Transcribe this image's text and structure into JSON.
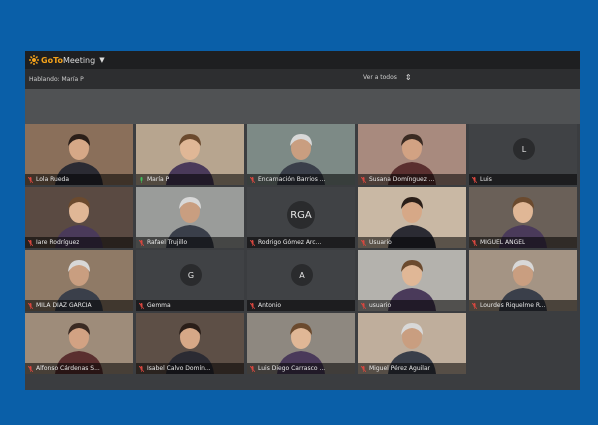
{
  "app": {
    "brand_bold": "GoTo",
    "brand_light": "Meeting",
    "speaking_label": "Hablando: María P",
    "view_all_label": "Ver a todos"
  },
  "colors": {
    "frame_blue": "#0a5fa8",
    "brand_orange": "#f4a21a",
    "mic_muted": "#d9473f",
    "mic_active": "#3fbf5a"
  },
  "participants": [
    {
      "name": "Lola Rueda",
      "type": "video",
      "mic": "muted"
    },
    {
      "name": "María P",
      "type": "video",
      "mic": "active"
    },
    {
      "name": "Encarnación Barrios ...",
      "type": "video",
      "mic": "muted"
    },
    {
      "name": "Susana Domínguez ...",
      "type": "video",
      "mic": "muted"
    },
    {
      "name": "Luis",
      "type": "avatar",
      "initials": "L",
      "mic": "muted"
    },
    {
      "name": "Iare Rodríguez",
      "type": "video",
      "mic": "muted"
    },
    {
      "name": "Rafael Trujillo",
      "type": "video",
      "mic": "muted"
    },
    {
      "name": "Rodrigo Gómez Arc...",
      "type": "avatar",
      "initials": "RGA",
      "mic": "muted"
    },
    {
      "name": "Usuario",
      "type": "video",
      "mic": "muted"
    },
    {
      "name": "MIGUEL ANGEL",
      "type": "video",
      "mic": "muted"
    },
    {
      "name": "MILA DÍAZ GARCÍA",
      "type": "video",
      "mic": "muted"
    },
    {
      "name": "Gemma",
      "type": "avatar",
      "initials": "G",
      "mic": "muted"
    },
    {
      "name": "Antonio",
      "type": "avatar",
      "initials": "A",
      "mic": "muted"
    },
    {
      "name": "usuario",
      "type": "video",
      "mic": "muted"
    },
    {
      "name": "Lourdes Riquelme R...",
      "type": "video",
      "mic": "muted"
    },
    {
      "name": "Alfonso Cárdenas S...",
      "type": "video",
      "mic": "muted"
    },
    {
      "name": "Isabel Calvo Domín...",
      "type": "video",
      "mic": "muted"
    },
    {
      "name": "Luis Diego Carrasco ...",
      "type": "video",
      "mic": "muted"
    },
    {
      "name": "Miguel Pérez Aguilar",
      "type": "video",
      "mic": "muted"
    }
  ]
}
